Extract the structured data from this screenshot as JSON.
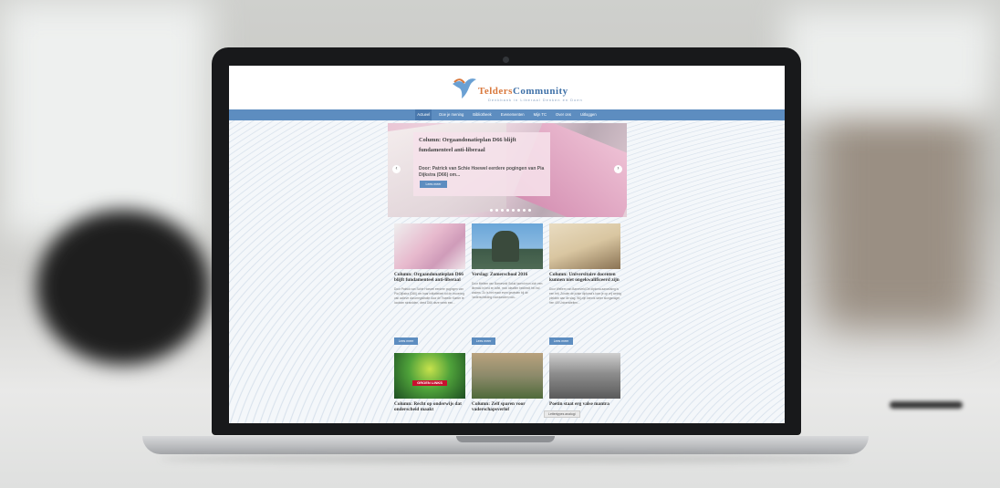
{
  "site": {
    "logo": {
      "part1": "Telders",
      "part2": "Community",
      "tagline": "Denkbank in Liberaal Denken en Doen"
    },
    "nav": [
      "Actueel",
      "Doe je mening",
      "Bibliotheek",
      "Evenementen",
      "Mijn TC",
      "Over ons",
      "Uitloggen"
    ],
    "hero": {
      "title": "Column: Orgaandonatieplan D66 blijft fundamenteel anti-liberaal",
      "intro": "Door: Patrick van Schie Hoewel eerdere pogingen van Pia Dijkstra (D66) om...",
      "button": "Lees meer",
      "prev": "‹",
      "next": "›"
    },
    "cards_row1": [
      {
        "title": "Column: Orgaandonatieplan D66 blijft fundamenteel anti-liberaal",
        "text": "Door Patrick van Schie Hoewel eerdere pogingen van Pia Dijkstra (D66) om haar initiatiefwet tot de invoering van actieve donorregistratie door de Tweede Kamer te loodsen strandden, deed D66 deze week een...",
        "button": "Lees meer"
      },
      {
        "title": "Verslag: Zomerschool 2016",
        "text": "Door Mellem van Barneveld Sokal lucent mon zich een liberaal in bed en tafel, mon idealiter bekleedt hel lnd anders. Zo is het maar even gewisten bij de 'onderscheiding vooraanzien van...",
        "button": "Lees meer"
      },
      {
        "title": "Column: Universitaire docenten kunnen niet ongekwalificeerd zijn",
        "text": "Door Wellem van Barneveld De diploma aanvulsing is een feit. Zonder de juiste diploma's kom je op vrij weinig plekken aan de slag. Wij zijn kennis sinter slungsnaget hen 4/5 Universiteiten...",
        "button": "Lees meer"
      }
    ],
    "cards_row2": [
      {
        "title": "Column: Recht op onderwijs dat onderscheid maakt",
        "badge": "GROEN LINKS"
      },
      {
        "title": "Column: Zelf sparen voor vaderschapsverlof"
      },
      {
        "title": "Poetin staat erg valse mantra"
      }
    ],
    "tooltip": "Lettertypes analogi",
    "colors": {
      "nav": "#5d8dc0",
      "logo_orange": "#d9783c",
      "logo_blue": "#3f71a8"
    }
  }
}
